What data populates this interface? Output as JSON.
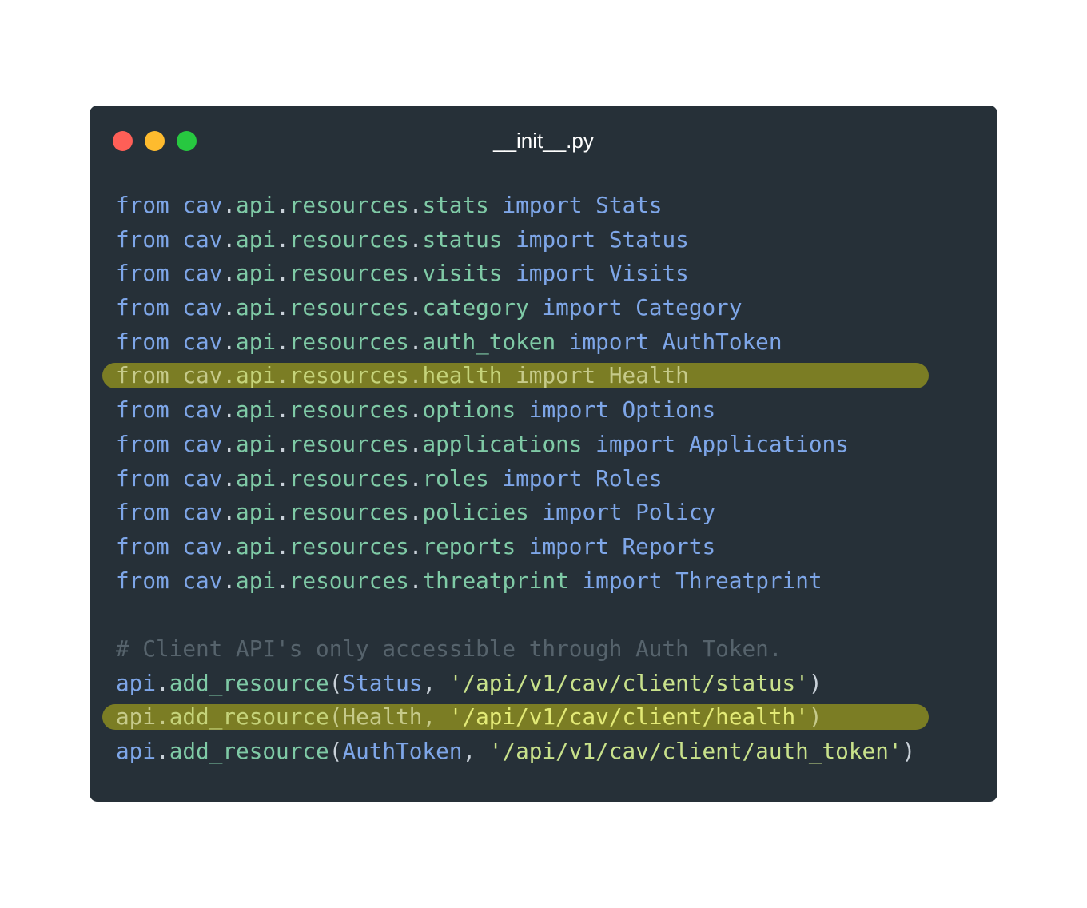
{
  "window": {
    "title": "__init__.py",
    "traffic_lights": [
      {
        "name": "close",
        "color": "#fe5f57"
      },
      {
        "name": "minimize",
        "color": "#febb2e"
      },
      {
        "name": "maximize",
        "color": "#27c840"
      }
    ],
    "background": "#263038",
    "highlight_color": "#7b7d24"
  },
  "code": {
    "imports": [
      {
        "kw_from": "from",
        "pkg": "cav",
        "path": [
          "api",
          "resources",
          "stats"
        ],
        "kw_import": "import",
        "name": "Stats",
        "highlighted": false
      },
      {
        "kw_from": "from",
        "pkg": "cav",
        "path": [
          "api",
          "resources",
          "status"
        ],
        "kw_import": "import",
        "name": "Status",
        "highlighted": false
      },
      {
        "kw_from": "from",
        "pkg": "cav",
        "path": [
          "api",
          "resources",
          "visits"
        ],
        "kw_import": "import",
        "name": "Visits",
        "highlighted": false
      },
      {
        "kw_from": "from",
        "pkg": "cav",
        "path": [
          "api",
          "resources",
          "category"
        ],
        "kw_import": "import",
        "name": "Category",
        "highlighted": false
      },
      {
        "kw_from": "from",
        "pkg": "cav",
        "path": [
          "api",
          "resources",
          "auth_token"
        ],
        "kw_import": "import",
        "name": "AuthToken",
        "highlighted": false
      },
      {
        "kw_from": "from",
        "pkg": "cav",
        "path": [
          "api",
          "resources",
          "health"
        ],
        "kw_import": "import",
        "name": "Health",
        "highlighted": true
      },
      {
        "kw_from": "from",
        "pkg": "cav",
        "path": [
          "api",
          "resources",
          "options"
        ],
        "kw_import": "import",
        "name": "Options",
        "highlighted": false
      },
      {
        "kw_from": "from",
        "pkg": "cav",
        "path": [
          "api",
          "resources",
          "applications"
        ],
        "kw_import": "import",
        "name": "Applications",
        "highlighted": false
      },
      {
        "kw_from": "from",
        "pkg": "cav",
        "path": [
          "api",
          "resources",
          "roles"
        ],
        "kw_import": "import",
        "name": "Roles",
        "highlighted": false
      },
      {
        "kw_from": "from",
        "pkg": "cav",
        "path": [
          "api",
          "resources",
          "policies"
        ],
        "kw_import": "import",
        "name": "Policy",
        "highlighted": false
      },
      {
        "kw_from": "from",
        "pkg": "cav",
        "path": [
          "api",
          "resources",
          "reports"
        ],
        "kw_import": "import",
        "name": "Reports",
        "highlighted": false
      },
      {
        "kw_from": "from",
        "pkg": "cav",
        "path": [
          "api",
          "resources",
          "threatprint"
        ],
        "kw_import": "import",
        "name": "Threatprint",
        "highlighted": false
      }
    ],
    "comment": "# Client API's only accessible through Auth Token.",
    "calls": [
      {
        "obj": "api",
        "method": "add_resource",
        "arg": "Status",
        "route": "'/api/v1/cav/client/status'",
        "highlighted": false
      },
      {
        "obj": "api",
        "method": "add_resource",
        "arg": "Health",
        "route": "'/api/v1/cav/client/health'",
        "highlighted": true
      },
      {
        "obj": "api",
        "method": "add_resource",
        "arg": "AuthToken",
        "route": "'/api/v1/cav/client/auth_token'",
        "highlighted": false
      }
    ]
  }
}
